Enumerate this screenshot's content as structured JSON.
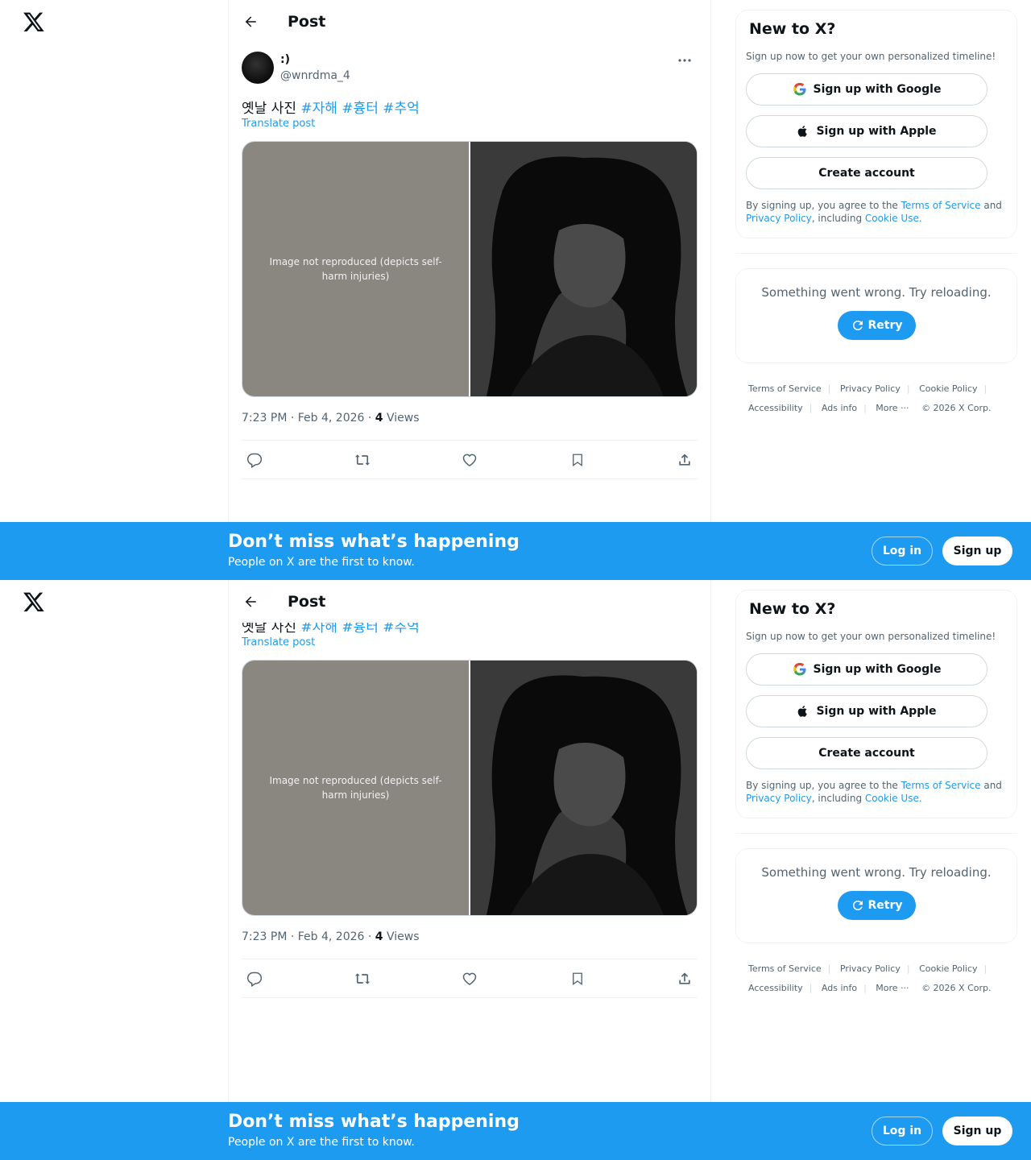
{
  "header": {
    "title": "Post"
  },
  "post": {
    "display_name": ":)",
    "handle": "@wnrdma_4",
    "text_plain": "옛날 사진 ",
    "hashtags": [
      "#자해",
      "#흉터",
      "#추억"
    ],
    "translate_label": "Translate post",
    "time": "7:23 PM · Feb 4, 2026 · ",
    "views_count": "4",
    "views_label": " Views",
    "media_note": "Image not reproduced (depicts self-harm injuries)"
  },
  "signup_card": {
    "title": "New to X?",
    "subtitle": "Sign up now to get your own personalized timeline!",
    "google_label": "Sign up with Google",
    "apple_label": "Sign up with Apple",
    "create_label": "Create account",
    "legal_1": "By signing up, you agree to the ",
    "terms_link": "Terms of Service",
    "legal_2": " and ",
    "privacy_link": "Privacy Policy",
    "legal_3": ", including ",
    "cookie_link": "Cookie Use.",
    "legal_4": ""
  },
  "trends_error": {
    "message": "Something went wrong. Try reloading.",
    "retry_label": "Retry"
  },
  "footer": {
    "terms": "Terms of Service",
    "privacy": "Privacy Policy",
    "cookie": "Cookie Policy",
    "accessibility": "Accessibility",
    "ads": "Ads info",
    "more": "More ···",
    "copyright": "© 2026 X Corp."
  },
  "banner": {
    "title": "Don’t miss what’s happening",
    "subtitle": "People on X are the first to know.",
    "login_label": "Log in",
    "signup_label": "Sign up"
  },
  "colors": {
    "accent": "#1d9bf0",
    "text": "#0f1419",
    "muted": "#536471",
    "border": "#eff3f4"
  },
  "icons": [
    "x-logo-icon",
    "back-arrow-icon",
    "more-icon",
    "reply-icon",
    "repost-icon",
    "like-icon",
    "bookmark-icon",
    "share-icon",
    "google-icon",
    "apple-icon",
    "retry-icon"
  ]
}
